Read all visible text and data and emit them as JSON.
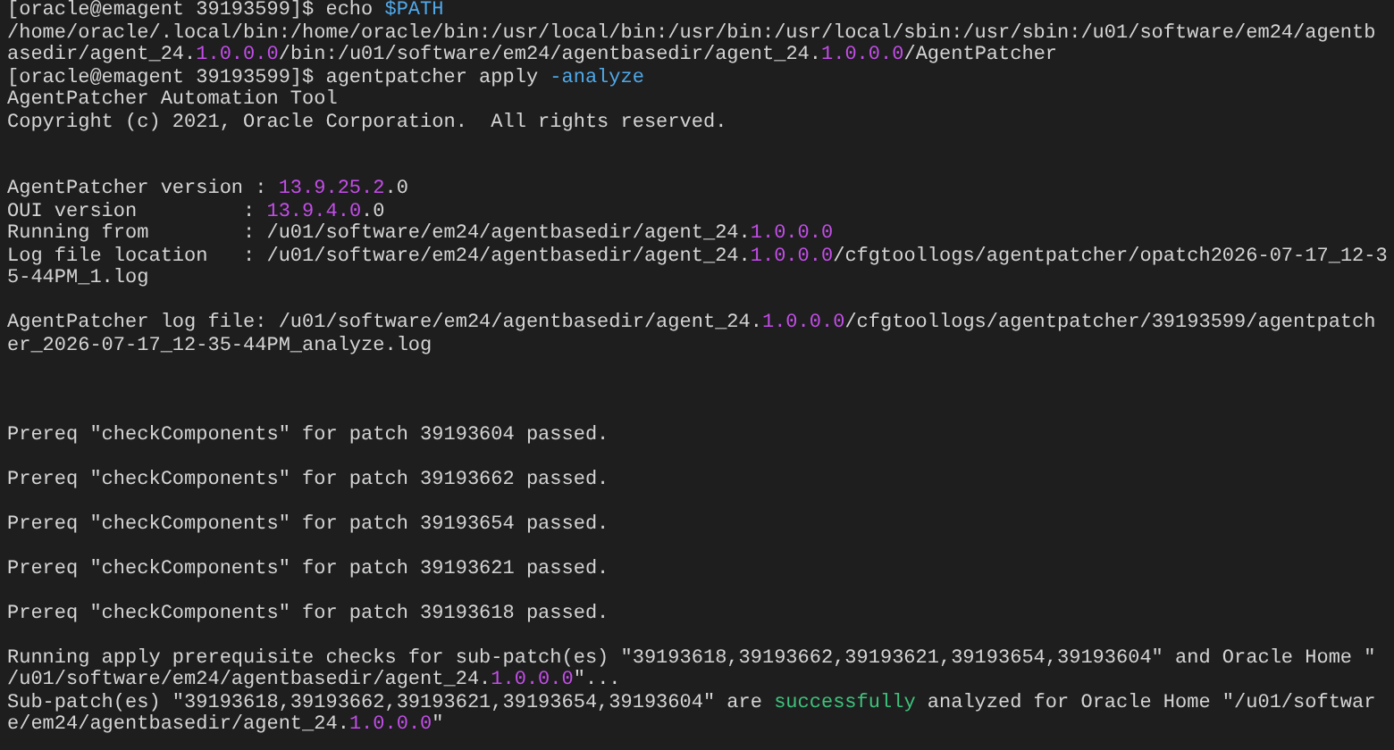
{
  "terminal": {
    "lines": [
      {
        "kind": "text",
        "segments": [
          {
            "kind": "plain",
            "text": "[oracle@emagent 39193599]$ echo "
          },
          {
            "kind": "option",
            "text": "$PATH"
          }
        ]
      },
      {
        "kind": "text",
        "segments": [
          {
            "kind": "plain",
            "text": "/home/oracle/.local/bin:/home/oracle/bin:/usr/local/bin:/usr/bin:/usr/local/sbin:/usr/sbin:/u01/software/em24/agentb"
          }
        ]
      },
      {
        "kind": "text",
        "segments": [
          {
            "kind": "plain",
            "text": "asedir/agent_24."
          },
          {
            "kind": "number",
            "text": "1.0.0.0"
          },
          {
            "kind": "plain",
            "text": "/bin:/u01/software/em24/agentbasedir/agent_24."
          },
          {
            "kind": "number",
            "text": "1.0.0.0"
          },
          {
            "kind": "plain",
            "text": "/AgentPatcher"
          }
        ]
      },
      {
        "kind": "text",
        "segments": [
          {
            "kind": "plain",
            "text": "[oracle@emagent 39193599]$ agentpatcher apply "
          },
          {
            "kind": "option",
            "text": "-analyze"
          }
        ]
      },
      {
        "kind": "text",
        "segments": [
          {
            "kind": "plain",
            "text": "AgentPatcher Automation Tool"
          }
        ]
      },
      {
        "kind": "text",
        "segments": [
          {
            "kind": "plain",
            "text": "Copyright (c) 2021, Oracle Corporation.  All rights reserved."
          }
        ]
      },
      {
        "kind": "blank"
      },
      {
        "kind": "blank"
      },
      {
        "kind": "text",
        "segments": [
          {
            "kind": "plain",
            "text": "AgentPatcher version : "
          },
          {
            "kind": "number",
            "text": "13.9.25.2"
          },
          {
            "kind": "plain",
            "text": ".0"
          }
        ]
      },
      {
        "kind": "text",
        "segments": [
          {
            "kind": "plain",
            "text": "OUI version         : "
          },
          {
            "kind": "number",
            "text": "13.9.4.0"
          },
          {
            "kind": "plain",
            "text": ".0"
          }
        ]
      },
      {
        "kind": "text",
        "segments": [
          {
            "kind": "plain",
            "text": "Running from        : /u01/software/em24/agentbasedir/agent_24."
          },
          {
            "kind": "number",
            "text": "1.0.0.0"
          }
        ]
      },
      {
        "kind": "text",
        "segments": [
          {
            "kind": "plain",
            "text": "Log file location   : /u01/software/em24/agentbasedir/agent_24."
          },
          {
            "kind": "number",
            "text": "1.0.0.0"
          },
          {
            "kind": "plain",
            "text": "/cfgtoollogs/agentpatcher/opatch2026-07-17_12-3"
          }
        ]
      },
      {
        "kind": "text",
        "segments": [
          {
            "kind": "plain",
            "text": "5-44PM_1.log"
          }
        ]
      },
      {
        "kind": "blank"
      },
      {
        "kind": "text",
        "segments": [
          {
            "kind": "plain",
            "text": "AgentPatcher log file: /u01/software/em24/agentbasedir/agent_24."
          },
          {
            "kind": "number",
            "text": "1.0.0.0"
          },
          {
            "kind": "plain",
            "text": "/cfgtoollogs/agentpatcher/39193599/agentpatch"
          }
        ]
      },
      {
        "kind": "text",
        "segments": [
          {
            "kind": "plain",
            "text": "er_2026-07-17_12-35-44PM_analyze.log"
          }
        ]
      },
      {
        "kind": "blank"
      },
      {
        "kind": "blank"
      },
      {
        "kind": "blank"
      },
      {
        "kind": "text",
        "segments": [
          {
            "kind": "plain",
            "text": "Prereq \"checkComponents\" for patch 39193604 passed."
          }
        ]
      },
      {
        "kind": "blank"
      },
      {
        "kind": "text",
        "segments": [
          {
            "kind": "plain",
            "text": "Prereq \"checkComponents\" for patch 39193662 passed."
          }
        ]
      },
      {
        "kind": "blank"
      },
      {
        "kind": "text",
        "segments": [
          {
            "kind": "plain",
            "text": "Prereq \"checkComponents\" for patch 39193654 passed."
          }
        ]
      },
      {
        "kind": "blank"
      },
      {
        "kind": "text",
        "segments": [
          {
            "kind": "plain",
            "text": "Prereq \"checkComponents\" for patch 39193621 passed."
          }
        ]
      },
      {
        "kind": "blank"
      },
      {
        "kind": "text",
        "segments": [
          {
            "kind": "plain",
            "text": "Prereq \"checkComponents\" for patch 39193618 passed."
          }
        ]
      },
      {
        "kind": "blank"
      },
      {
        "kind": "text",
        "segments": [
          {
            "kind": "plain",
            "text": "Running apply prerequisite checks for sub-patch(es) \"39193618,39193662,39193621,39193654,39193604\" and Oracle Home \""
          }
        ]
      },
      {
        "kind": "text",
        "segments": [
          {
            "kind": "plain",
            "text": "/u01/software/em24/agentbasedir/agent_24."
          },
          {
            "kind": "number",
            "text": "1.0.0.0"
          },
          {
            "kind": "plain",
            "text": "\"..."
          }
        ]
      },
      {
        "kind": "text",
        "segments": [
          {
            "kind": "plain",
            "text": "Sub-patch(es) \"39193618,39193662,39193621,39193654,39193604\" are "
          },
          {
            "kind": "success",
            "text": "successfully"
          },
          {
            "kind": "plain",
            "text": " analyzed for Oracle Home \"/u01/softwar"
          }
        ]
      },
      {
        "kind": "text",
        "segments": [
          {
            "kind": "plain",
            "text": "e/em24/agentbasedir/agent_24."
          },
          {
            "kind": "number",
            "text": "1.0.0.0"
          },
          {
            "kind": "plain",
            "text": "\""
          }
        ]
      }
    ]
  }
}
